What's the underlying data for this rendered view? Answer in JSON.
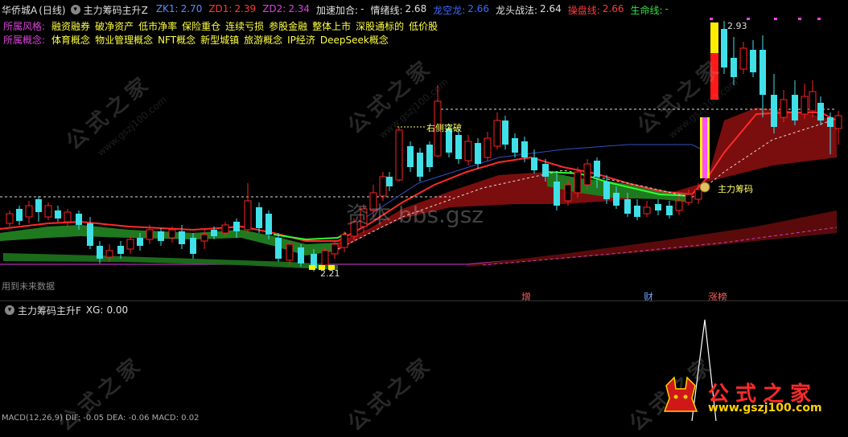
{
  "header": {
    "stock": "华侨城A",
    "period": "(日线)",
    "indicator_title": "主力筹码主升Z",
    "items": [
      {
        "key": "ZK1:",
        "val": "2.70",
        "color": "#5a8cff"
      },
      {
        "key": "ZD1:",
        "val": "2.39",
        "color": "#ff3a3a"
      },
      {
        "key": "ZD2:",
        "val": "2.34",
        "color": "#e040e0"
      },
      {
        "key": "加速加合:",
        "val": "-",
        "color": "#e0e0e0"
      },
      {
        "key": "情绪线:",
        "val": "2.68",
        "color": "#e0e0e0"
      },
      {
        "key": "龙空龙:",
        "val": "2.66",
        "color": "#3b6bff"
      },
      {
        "key": "龙头战法:",
        "val": "2.64",
        "color": "#e0e0e0"
      },
      {
        "key": "操盘线:",
        "val": "2.66",
        "color": "#ff3a3a"
      },
      {
        "key": "生命线:",
        "val": "-",
        "color": "#33e040"
      }
    ]
  },
  "style_row": {
    "label": "所属风格:",
    "tags": [
      "融资融券",
      "破净资产",
      "低市净率",
      "保险重仓",
      "连续亏损",
      "参股金融",
      "整体上市",
      "深股通标的",
      "低价股"
    ]
  },
  "concept_row": {
    "label": "所属概念:",
    "tags": [
      "体育概念",
      "物业管理概念",
      "NFT概念",
      "新型城镇",
      "旅游概念",
      "IP经济",
      "DeepSeek概念"
    ]
  },
  "annotations": {
    "breakout": "右侧突破",
    "chip": "主力筹码",
    "high": "2.93",
    "low": "2.21",
    "future_data": "用到未来数据",
    "watermark_mid": "资本 bbs.gsz"
  },
  "events": [
    {
      "label": "增",
      "color": "#ff5a5a"
    },
    {
      "label": "财",
      "color": "#6aa0ff"
    },
    {
      "label": "涨榜",
      "color": "#ff5a5a"
    }
  ],
  "sub_indicator": {
    "title": "主力筹码主升F",
    "xg_label": "XG:",
    "xg_value": "0.00"
  },
  "bottom_text": "MACD(12,26,9) DIF: -0.05  DEA: -0.06  MACD: 0.02",
  "watermark": {
    "text": "公式之家",
    "url": "www.gszj100.com"
  },
  "logo": {
    "text": "公式之家",
    "url": "www.gszj100.com"
  },
  "colors": {
    "up": "#ff2020",
    "down": "#40e0e8",
    "ma_red": "#ff2a2a",
    "ma_green": "#30ff30",
    "ribbon_red": "#8a1010",
    "ribbon_green": "#1a6a1a",
    "purple": "#b030b0"
  },
  "chart_data": {
    "type": "candlestick",
    "price_range": [
      2.21,
      2.93
    ],
    "annotated_high": 2.93,
    "annotated_low": 2.21,
    "xg_peak": 1.0
  }
}
